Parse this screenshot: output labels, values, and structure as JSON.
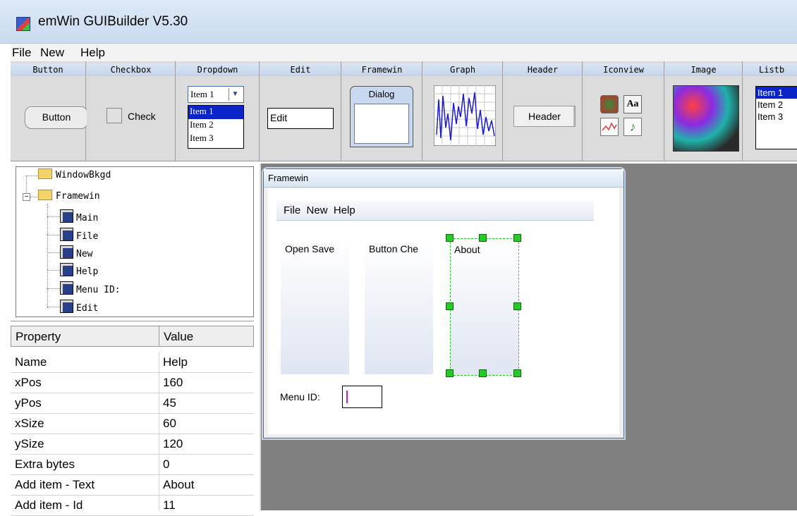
{
  "window": {
    "title": "emWin GUIBuilder V5.30"
  },
  "menubar": {
    "items": [
      "File",
      "New",
      "Help"
    ]
  },
  "palette": {
    "button": {
      "label": "Button",
      "sample": "Button"
    },
    "checkbox": {
      "label": "Checkbox",
      "sample": "Check"
    },
    "dropdown": {
      "label": "Dropdown",
      "selected": "Item 1",
      "items": [
        "Item 1",
        "Item 2",
        "Item 3"
      ]
    },
    "edit": {
      "label": "Edit",
      "sample": "Edit"
    },
    "framewin": {
      "label": "Framewin",
      "sample": "Dialog"
    },
    "graph": {
      "label": "Graph"
    },
    "header": {
      "label": "Header",
      "sample": "Header"
    },
    "iconview": {
      "label": "Iconview",
      "text_icon": "Aa"
    },
    "image": {
      "label": "Image"
    },
    "listbox": {
      "label": "Listb",
      "items": [
        "Item 1",
        "Item 2",
        "Item 3"
      ]
    }
  },
  "tree": {
    "root": "WindowBkgd",
    "framewin": "Framewin",
    "children": [
      "Main",
      "File",
      "New",
      "Help",
      "Menu ID:",
      "Edit"
    ]
  },
  "properties": {
    "col_property": "Property",
    "col_value": "Value",
    "rows": [
      {
        "name": "Name",
        "value": "Help"
      },
      {
        "name": "xPos",
        "value": "160"
      },
      {
        "name": "yPos",
        "value": "45"
      },
      {
        "name": "xSize",
        "value": "60"
      },
      {
        "name": "ySize",
        "value": "120"
      },
      {
        "name": "Extra bytes",
        "value": "0"
      },
      {
        "name": "Add item - Text",
        "value": "About"
      },
      {
        "name": "Add item - Id",
        "value": "11"
      }
    ]
  },
  "canvas": {
    "framewin_title": "Framewin",
    "menu_items": [
      "File",
      "New",
      "Help"
    ],
    "submenu_file": "Open  Save",
    "submenu_new": "Button  Che",
    "submenu_help": "About",
    "label_menuid": "Menu ID:"
  },
  "colors": {
    "selection": "#0a24c8",
    "handle": "#22cc22",
    "canvas_bg": "#808080"
  }
}
